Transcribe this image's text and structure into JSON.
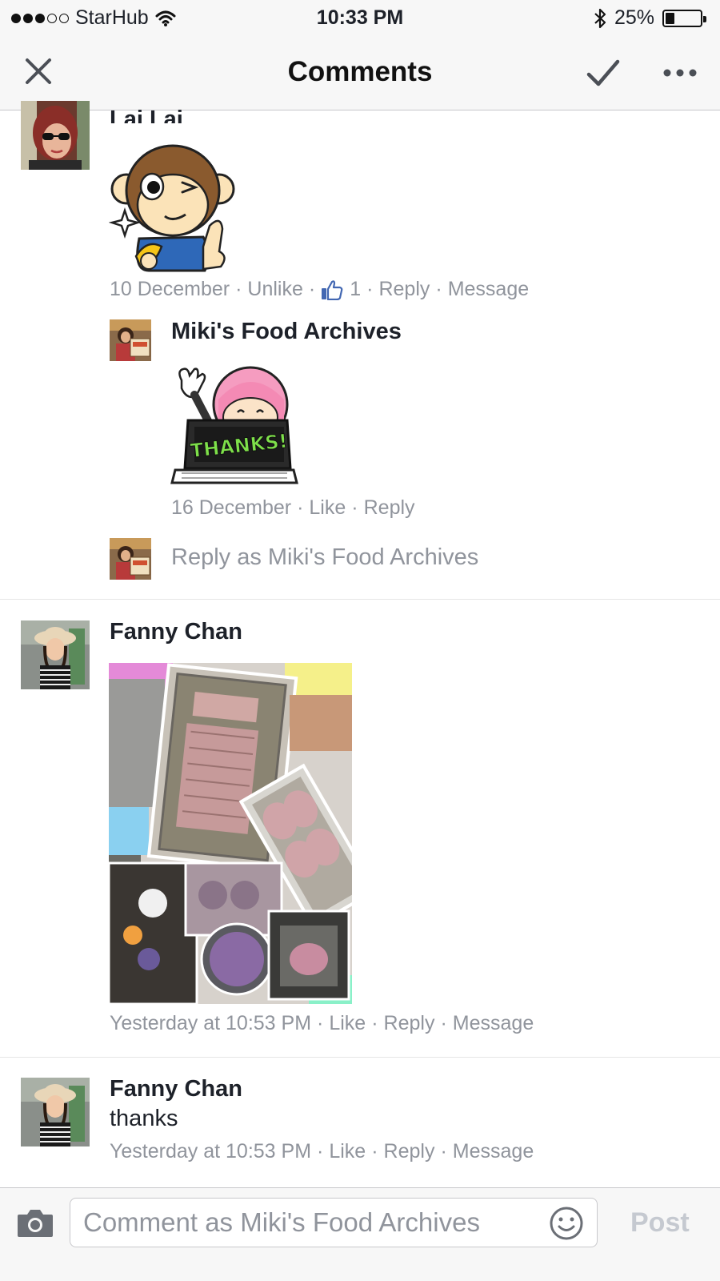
{
  "status_bar": {
    "carrier": "StarHub",
    "time": "10:33 PM",
    "battery": "25%",
    "battery_level": 0.25
  },
  "nav": {
    "title": "Comments"
  },
  "comments": [
    {
      "author": "Lai Lai",
      "sticker": "monkey-wink-sticker",
      "date": "10 December",
      "actions": {
        "unlike": "Unlike",
        "like_count": "1",
        "reply": "Reply",
        "message": "Message"
      },
      "replies": [
        {
          "author": "Miki's Food Archives",
          "sticker": "thanks-laptop-sticker",
          "sticker_text": "THANKS!",
          "date": "16 December",
          "actions": {
            "like": "Like",
            "reply": "Reply"
          }
        }
      ],
      "reply_prompt": "Reply as Miki's Food Archives"
    },
    {
      "author": "Fanny Chan",
      "photo": "bread-collage-photo",
      "date": "Yesterday at 10:53 PM",
      "actions": {
        "like": "Like",
        "reply": "Reply",
        "message": "Message"
      }
    },
    {
      "author": "Fanny Chan",
      "text": "thanks",
      "date": "Yesterday at 10:53 PM",
      "actions": {
        "like": "Like",
        "reply": "Reply",
        "message": "Message"
      }
    }
  ],
  "composer": {
    "placeholder": "Comment as Miki's Food Archives",
    "post_label": "Post"
  },
  "colors": {
    "bar_bg": "#f7f7f7",
    "meta_text": "#90949c",
    "like_blue": "#4267b2",
    "post_disabled": "#c5c9d0"
  }
}
